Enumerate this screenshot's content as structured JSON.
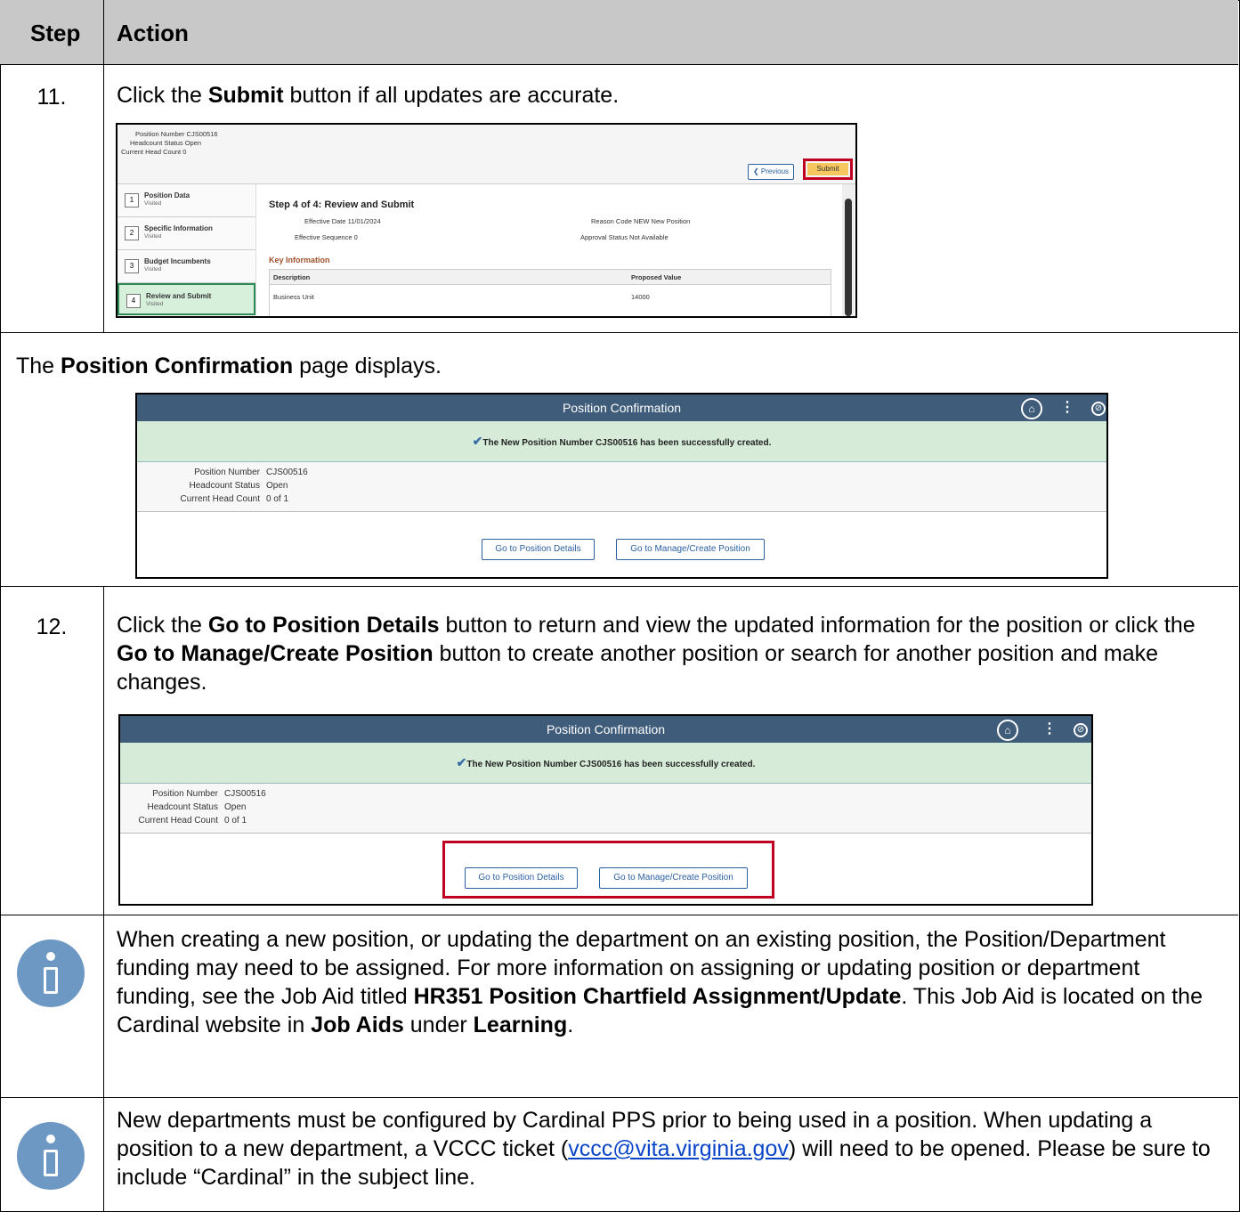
{
  "table": {
    "header_step": "Step",
    "header_action": "Action"
  },
  "rows": {
    "r11": {
      "num": "11.",
      "pre": "Click the ",
      "bold": "Submit",
      "post": " button if all updates are accurate."
    },
    "confirm_note": {
      "pre": "The ",
      "bold": "Position Confirmation",
      "post": " page displays."
    },
    "r12": {
      "num": "12.",
      "t1": "Click the ",
      "b1": "Go to Position Details",
      "t2": " button to return and view the updated information for the position or click the ",
      "b2": "Go to Manage/Create Position",
      "t3": " button to create another position or search for another position and make changes."
    },
    "info1": {
      "t1": "When creating a new position, or updating the department on an existing position, the Position/Department funding may need to be assigned. For more information on assigning or updating position or department funding, see the Job Aid titled ",
      "b1": "HR351 Position Chartfield Assignment/Update",
      "t2": ". This Job Aid is located on the Cardinal website in ",
      "b2": "Job Aids",
      "t3": " under ",
      "b3": "Learning",
      "t4": "."
    },
    "info2": {
      "t1": "New departments must be configured by Cardinal PPS prior to being used in a position. When updating a position to a new department, a VCCC ticket (",
      "link": "vccc@vita.virginia.gov",
      "t2": ") will need to be opened. Please be sure to include “Cardinal” in the subject line."
    }
  },
  "ss_review": {
    "position_number": "Position Number  CJS00516",
    "headcount_status": "Headcount Status  Open",
    "current_head_count": "Current Head Count  0",
    "previous": "❮ Previous",
    "submit": "Submit",
    "nav": [
      {
        "num": "1",
        "title": "Position Data",
        "status": "Visited"
      },
      {
        "num": "2",
        "title": "Specific Information",
        "status": "Visited"
      },
      {
        "num": "3",
        "title": "Budget Incumbents",
        "status": "Visited"
      },
      {
        "num": "4",
        "title": "Review and Submit",
        "status": "Visited"
      }
    ],
    "step_title": "Step 4 of 4: Review and Submit",
    "effective_date": "Effective Date  11/01/2024",
    "effective_sequence": "Effective Sequence  0",
    "reason_code": "Reason Code  NEW  New Position",
    "approval_status": "Approval Status  Not Available",
    "key_information": "Key Information",
    "col_description": "Description",
    "col_proposed": "Proposed Value",
    "row_desc": "Business Unit",
    "row_value": "14000"
  },
  "confirm": {
    "title": "Position Confirmation",
    "message": "The New Position Number CJS00516 has been successfully created.",
    "labels": [
      "Position Number",
      "Headcount Status",
      "Current Head Count"
    ],
    "values": [
      "CJS00516",
      "Open",
      "0 of 1"
    ],
    "btn_details": "Go to Position Details",
    "btn_manage": "Go to Manage/Create Position",
    "home_icon": "⌂",
    "kebab_icon": "⋮",
    "compass_icon": "⊘"
  }
}
